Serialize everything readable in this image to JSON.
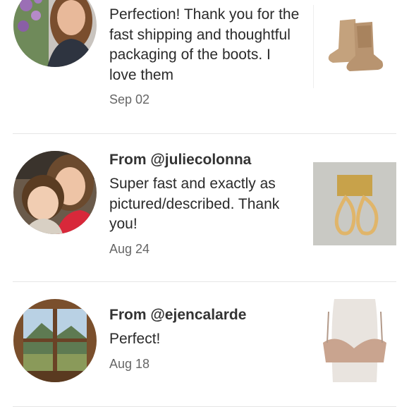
{
  "reviews": [
    {
      "from": "",
      "message": "Perfection! Thank you for the fast shipping and thoughtful packaging of the boots. I love them",
      "date": "Sep 02",
      "avatar_icon": "woman-with-flowers-avatar",
      "item_icon": "cowboy-boots-thumbnail"
    },
    {
      "from": "From @juliecolonna",
      "message": "Super fast and exactly as pictured/described. Thank you!",
      "date": "Aug 24",
      "avatar_icon": "mother-and-child-avatar",
      "item_icon": "gold-teardrop-earrings-thumbnail"
    },
    {
      "from": "From @ejencalarde",
      "message": "Perfect!",
      "date": "Aug 18",
      "avatar_icon": "window-mountain-view-avatar",
      "item_icon": "nude-strapless-bra-thumbnail"
    }
  ],
  "colors": {
    "text": "#2a2a2a",
    "from": "#333333",
    "date": "#666666",
    "divider": "#e6e6e6"
  }
}
